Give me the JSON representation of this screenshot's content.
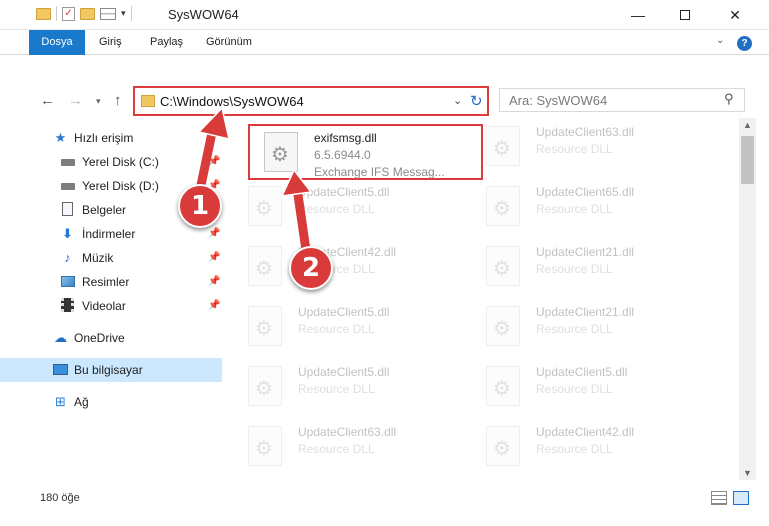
{
  "window": {
    "title": "SysWOW64",
    "minimize_glyph": "—",
    "close_glyph": "✕"
  },
  "ribbon": {
    "tabs": [
      "Dosya",
      "Giriş",
      "Paylaş",
      "Görünüm"
    ],
    "help": "?"
  },
  "address": {
    "path": "C:\\Windows\\SysWOW64"
  },
  "search": {
    "placeholder": "Ara: SysWOW64"
  },
  "sidebar": {
    "items": [
      {
        "label": "Hızlı erişim",
        "icon": "star-icon"
      },
      {
        "label": "Yerel Disk (C:)",
        "icon": "drive-icon"
      },
      {
        "label": "Yerel Disk (D:)",
        "icon": "drive-icon"
      },
      {
        "label": "Belgeler",
        "icon": "documents-icon"
      },
      {
        "label": "İndirmeler",
        "icon": "downloads-icon"
      },
      {
        "label": "Müzik",
        "icon": "music-icon"
      },
      {
        "label": "Resimler",
        "icon": "pictures-icon"
      },
      {
        "label": "Videolar",
        "icon": "videos-icon"
      },
      {
        "label": "OneDrive",
        "icon": "onedrive-icon"
      },
      {
        "label": "Bu bilgisayar",
        "icon": "computer-icon"
      },
      {
        "label": "Ağ",
        "icon": "network-icon"
      }
    ]
  },
  "files": {
    "highlighted": {
      "name": "exifsmsg.dll",
      "version": "6.5.6944.0",
      "description": "Exchange IFS Messag..."
    },
    "left": [
      {
        "name": "UpdateClient5.dll",
        "type": "Resource DLL"
      },
      {
        "name": "UpdateClient42.dll",
        "type": "Resource DLL"
      },
      {
        "name": "UpdateClient5.dll",
        "type": "Resource DLL"
      },
      {
        "name": "UpdateClient5.dll",
        "type": "Resource DLL"
      },
      {
        "name": "UpdateClient63.dll",
        "type": "Resource DLL"
      }
    ],
    "right": [
      {
        "name": "UpdateClient63.dll",
        "type": "Resource DLL"
      },
      {
        "name": "UpdateClient65.dll",
        "type": "Resource DLL"
      },
      {
        "name": "UpdateClient21.dll",
        "type": "Resource DLL"
      },
      {
        "name": "UpdateClient21.dll",
        "type": "Resource DLL"
      },
      {
        "name": "UpdateClient5.dll",
        "type": "Resource DLL"
      },
      {
        "name": "UpdateClient42.dll",
        "type": "Resource DLL"
      }
    ]
  },
  "status": {
    "count": "180 öğe"
  },
  "callouts": [
    "1",
    "2"
  ],
  "colors": {
    "accent": "#1979ca",
    "highlight": "#dd3b3b",
    "selection": "#cce8ff"
  }
}
